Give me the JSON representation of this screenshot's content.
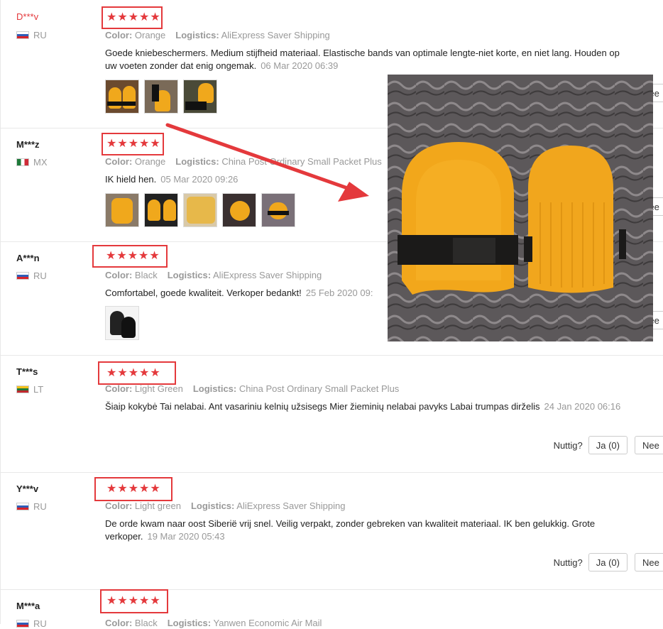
{
  "labels": {
    "color": "Color:",
    "logistics": "Logistics:",
    "helpful": "Nuttig?",
    "yes": "Ja (0)",
    "no": "Nee"
  },
  "icons": {
    "star": "★",
    "flag": "flag-icon"
  },
  "colors": {
    "accent": "#e4393c",
    "muted": "#999999",
    "pad": "#f0a81c"
  },
  "reviews": [
    {
      "user": "D***v",
      "country": "RU",
      "rating": 5,
      "color": "Orange",
      "logistics": "AliExpress Saver Shipping",
      "text": "Goede kniebeschermers. Medium stijfheid materiaal. Elastische bands van optimale lengte-niet korte, en niet lang. Houden op uw voeten zonder dat enig ongemak.",
      "date": "06 Mar 2020 06:39"
    },
    {
      "user": "M***z",
      "country": "MX",
      "rating": 5,
      "color": "Orange",
      "logistics": "China Post Ordinary Small Packet Plus",
      "text": "IK hield hen.",
      "date": "05 Mar 2020 09:26"
    },
    {
      "user": "A***n",
      "country": "RU",
      "rating": 5,
      "color": "Black",
      "logistics": "AliExpress Saver Shipping",
      "text": "Comfortabel, goede kwaliteit. Verkoper bedankt!",
      "date": "25 Feb 2020 09:"
    },
    {
      "user": "T***s",
      "country": "LT",
      "rating": 5,
      "color": "Light Green",
      "logistics": "China Post Ordinary Small Packet Plus",
      "text": "Šiaip kokybė Tai nelabai. Ant vasariniu kelnių užsisegs Mier žieminių nelabai pavyks Labai trumpas dirželis",
      "date": "24 Jan 2020 06:16"
    },
    {
      "user": "Y***v",
      "country": "RU",
      "rating": 5,
      "color": "Light green",
      "logistics": "AliExpress Saver Shipping",
      "text": "De orde kwam naar oost Siberië vrij snel. Veilig verpakt, zonder gebreken van kwaliteit materiaal. IK ben gelukkig. Grote verkoper.",
      "date": "19 Mar 2020 05:43"
    },
    {
      "user": "M***a",
      "country": "RU",
      "rating": 5,
      "color": "Black",
      "logistics": "Yanwen Economic Air Mail",
      "text": "",
      "date": ""
    }
  ]
}
